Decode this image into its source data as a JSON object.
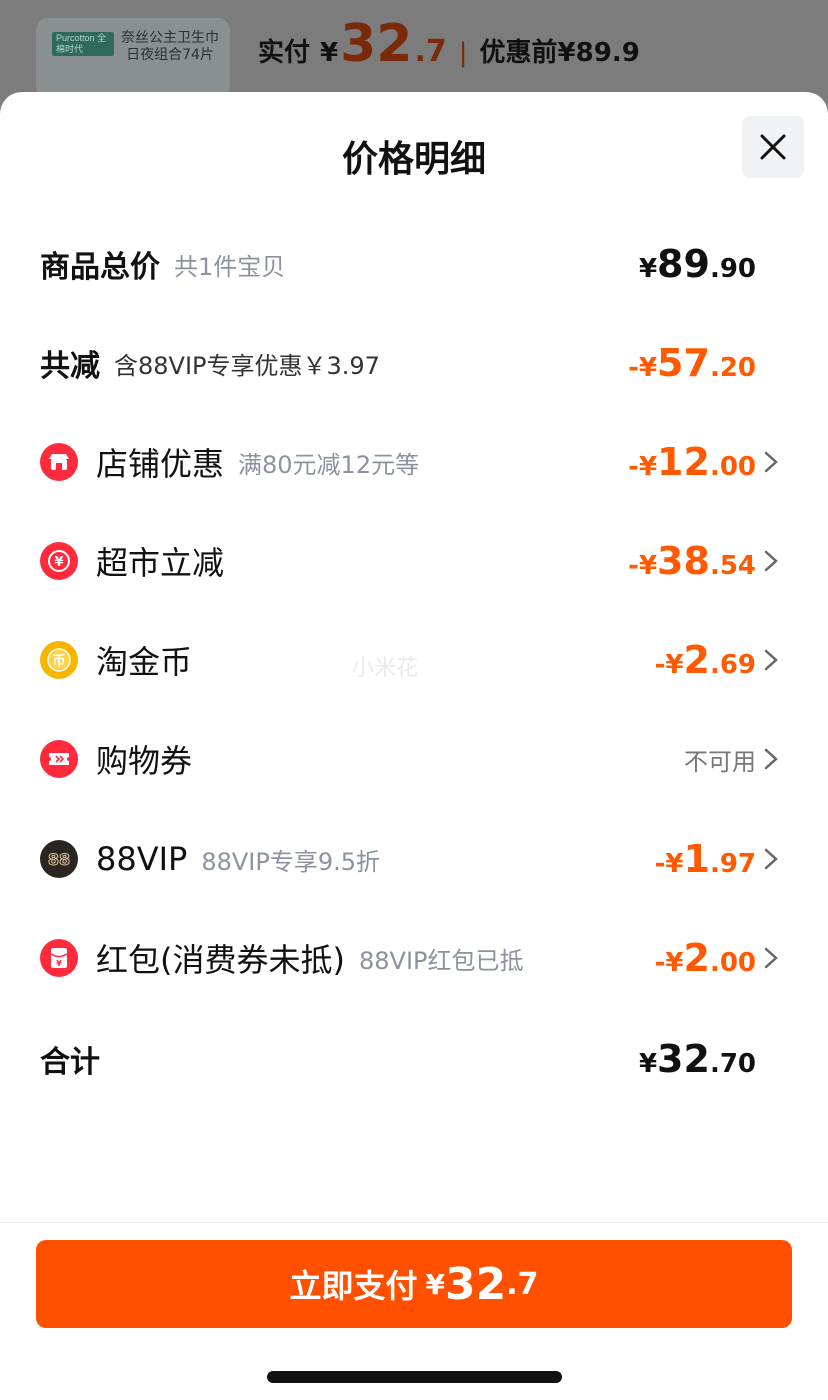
{
  "background": {
    "product_brand": "Purcotton 全棉时代",
    "product_name": "奈丝公主卫生巾日夜组合74片",
    "paid_label": "实付",
    "paid_currency": "¥",
    "paid_int": "32",
    "paid_dec": ".7",
    "separator": "|",
    "before_label": "优惠前",
    "before_amount": "¥89.9"
  },
  "sheet": {
    "title": "价格明细"
  },
  "rows": {
    "total_goods": {
      "label": "商品总价",
      "sub": "共1件宝贝",
      "currency": "¥",
      "int": "89",
      "dec": ".90"
    },
    "total_reduce": {
      "label": "共减",
      "sub": "含88VIP专享优惠￥3.97",
      "currency": "-¥",
      "int": "57",
      "dec": ".20"
    },
    "store": {
      "label": "店铺优惠",
      "sub": "满80元减12元等",
      "currency": "-¥",
      "int": "12",
      "dec": ".00"
    },
    "supermarket": {
      "label": "超市立减",
      "currency": "-¥",
      "int": "38",
      "dec": ".54"
    },
    "coins": {
      "label": "淘金币",
      "currency": "-¥",
      "int": "2",
      "dec": ".69"
    },
    "coupon": {
      "label": "购物券",
      "status": "不可用"
    },
    "vip": {
      "label": "88VIP",
      "sub": "88VIP专享9.5折",
      "currency": "-¥",
      "int": "1",
      "dec": ".97"
    },
    "redpacket": {
      "label": "红包(消费券未抵)",
      "sub": "88VIP红包已抵",
      "currency": "-¥",
      "int": "2",
      "dec": ".00"
    },
    "sum": {
      "label": "合计",
      "currency": "¥",
      "int": "32",
      "dec": ".70"
    }
  },
  "watermark": "小米花",
  "pay_button": {
    "label": "立即支付",
    "currency": "¥",
    "int": "32",
    "dec": ".7"
  },
  "icons": {
    "store": "store-icon",
    "supermarket": "yuan-coin-icon",
    "coins": "taojinbi-coin-icon",
    "coupon": "ticket-icon",
    "vip": "88vip-badge-icon",
    "redpacket": "red-packet-icon",
    "close": "close-icon",
    "chevron": "chevron-right-icon"
  },
  "colors": {
    "accent": "#ff5000",
    "amount_orange": "#ff5a00",
    "icon_red": "#ff2b3d",
    "coin_gold": "#f7b500",
    "vip_dark": "#2b2521"
  }
}
